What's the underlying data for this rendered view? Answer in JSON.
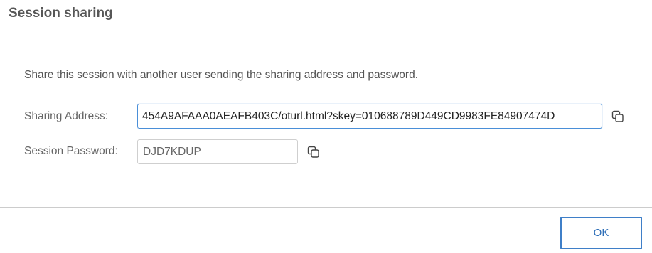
{
  "dialog": {
    "title": "Session sharing",
    "description": "Share this session with another user sending the sharing address and password."
  },
  "fields": {
    "address": {
      "label": "Sharing Address:",
      "value": "454A9AFAAA0AEAFB403C/oturl.html?skey=010688789D449CD9983FE84907474D"
    },
    "password": {
      "label": "Session Password:",
      "value": "DJD7KDUP"
    }
  },
  "icons": {
    "copy_address": "copy-icon",
    "copy_password": "copy-icon"
  },
  "colors": {
    "accent": "#3f7fc8",
    "focus_border": "#4a8fd8",
    "divider": "#cccccc"
  },
  "footer": {
    "ok_label": "OK"
  }
}
